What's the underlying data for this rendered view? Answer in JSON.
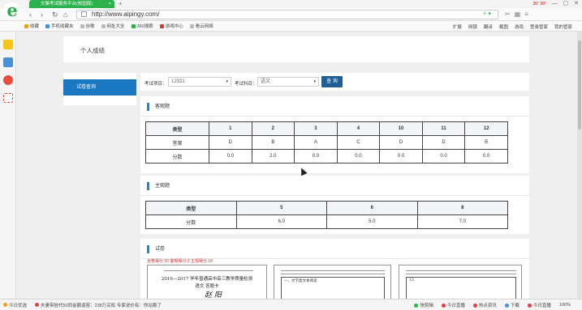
{
  "browser": {
    "tab_title": "文聚考试服务平台(校园版)",
    "tab_close": "×",
    "new_tab": "+",
    "url": "http://www.aipingy.com/",
    "nav_back": "‹",
    "nav_forward": "›",
    "nav_refresh": "↻",
    "nav_home": "⌂",
    "addr_icons": "⚡ ▾",
    "weather": "26° 30°",
    "win_min": "—",
    "win_max": "▢",
    "win_close": "✕",
    "nav_right_icons": [
      "✂",
      "▦",
      "≡"
    ],
    "bookmarks_left": [
      "收藏",
      "手机收藏夹",
      "谷歌",
      "网址大全",
      "360搜索",
      "游戏中心",
      "看云网络"
    ],
    "bookmarks_right": [
      "扩展",
      "网银",
      "翻译",
      "截图",
      "游戏",
      "登录管家",
      "我的管家"
    ]
  },
  "page": {
    "header_title": "个人成绩",
    "menu_item": "试卷查询",
    "filter": {
      "project_label": "考试项目：",
      "project_value": "12321",
      "subject_label": "考试科目：",
      "subject_value": "语文",
      "caret": "▾",
      "query_button": "查 询"
    },
    "objective": {
      "title": "客观题",
      "row_labels": [
        "类型",
        "答案",
        "分数"
      ],
      "questions": [
        "1",
        "2",
        "3",
        "4",
        "10",
        "11",
        "12"
      ],
      "answers": [
        "D",
        "B",
        "A",
        "C",
        "D",
        "D",
        "B"
      ],
      "scores": [
        "0.0",
        "2.0",
        "0.0",
        "0.0",
        "0.0",
        "0.0",
        "0.0"
      ]
    },
    "subjective": {
      "title": "主观题",
      "row_labels": [
        "类型",
        "分数"
      ],
      "questions": [
        "5",
        "6",
        "8"
      ],
      "scores": [
        "6.0",
        "5.0",
        "7.0"
      ]
    },
    "paper": {
      "title": "试卷",
      "score_line": "全卷得分:20  客观得分:2  主观得分:18",
      "doc_title": "2016—2017 学年普通高中高三教学质量检测",
      "doc_subtitle": "语文  答题卡",
      "doc_section": "一、文学类文本阅读",
      "doc_section2": "13.",
      "doc_name": "赵 阳"
    }
  },
  "statusbar": {
    "left": [
      "今日优选",
      "夫妻带娃代50同金额逼窑：238万买松 专家说价有：你站稳了"
    ],
    "right": [
      "快剪辑",
      "今日直播",
      "热点资讯",
      "下载",
      "今日直播",
      "100%"
    ]
  }
}
